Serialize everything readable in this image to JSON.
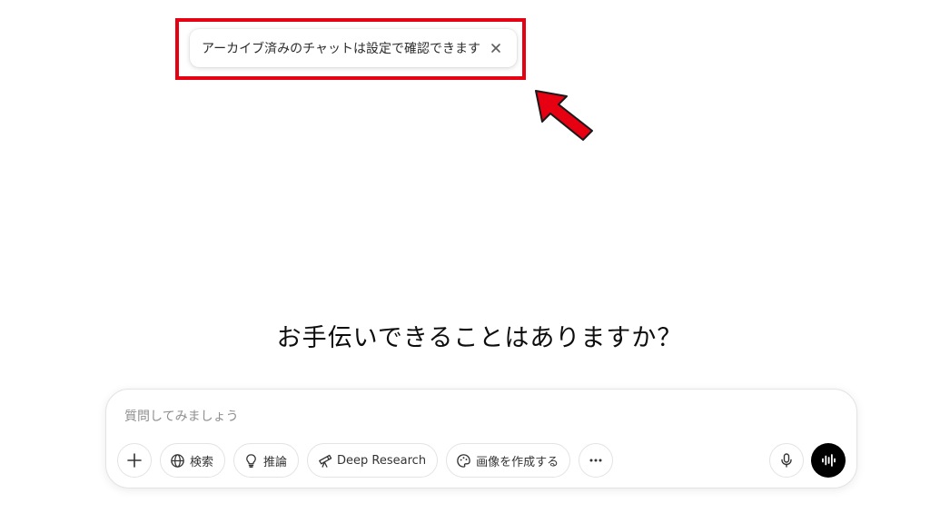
{
  "toast": {
    "message": "アーカイブ済みのチャットは設定で確認できます",
    "close_icon": "close-icon"
  },
  "annotation": {
    "highlight_color": "#e60012",
    "arrow_color": "#e60012"
  },
  "main": {
    "heading": "お手伝いできることはありますか？"
  },
  "composer": {
    "placeholder": "質問してみましょう",
    "value": "",
    "tools": {
      "add_icon": "plus-icon",
      "search_label": "検索",
      "search_icon": "globe-icon",
      "reason_label": "推論",
      "reason_icon": "lightbulb-icon",
      "deep_research_label": "Deep Research",
      "deep_research_icon": "telescope-icon",
      "image_label": "画像を作成する",
      "image_icon": "palette-icon",
      "more_icon": "ellipsis-icon"
    },
    "mic_icon": "microphone-icon",
    "voice_icon": "voice-waveform-icon"
  }
}
